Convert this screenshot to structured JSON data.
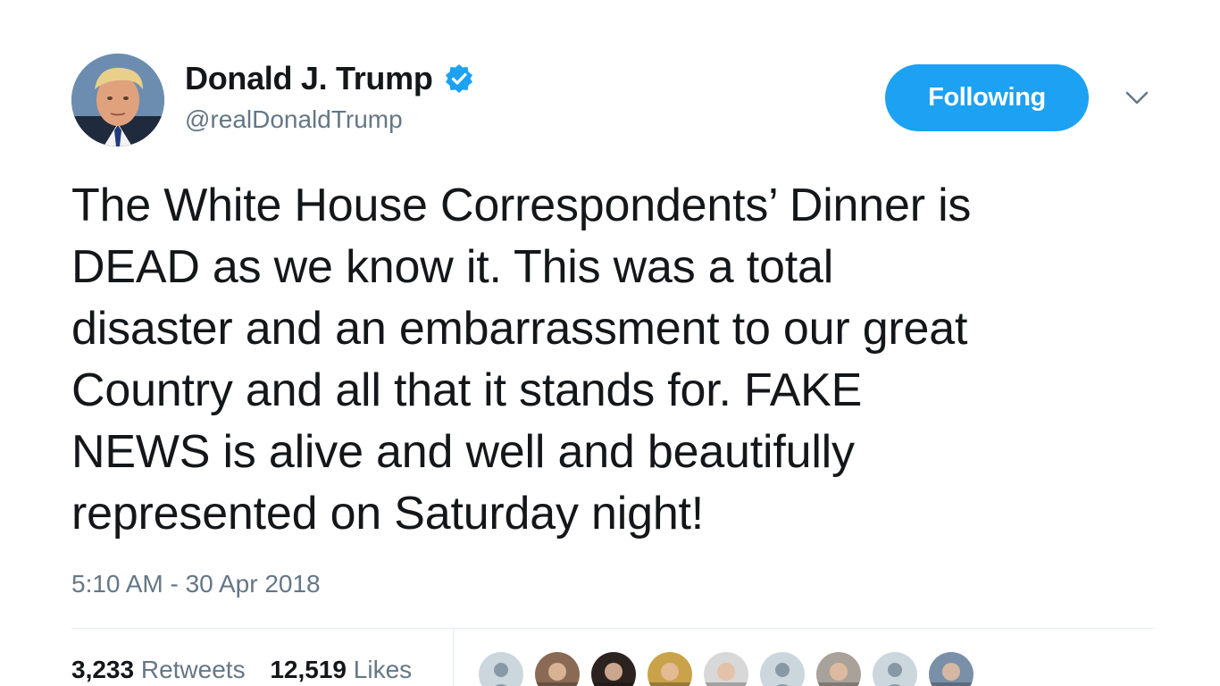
{
  "user": {
    "display_name": "Donald J. Trump",
    "handle": "@realDonaldTrump",
    "verified": true,
    "avatar_icon": "profile-photo"
  },
  "follow_button": {
    "label": "Following"
  },
  "menu": {
    "icon": "chevron-down-icon"
  },
  "tweet": {
    "text": "The White House Correspondents’ Dinner is\nDEAD as we know it. This was a total\ndisaster and an embarrassment to our great\nCountry and all that it stands for. FAKE\nNEWS is alive and well and beautifully\nrepresented on Saturday night!",
    "timestamp": "5:10 AM - 30 Apr 2018"
  },
  "stats": {
    "retweets_count": "3,233",
    "retweets_label": "Retweets",
    "likes_count": "12,519",
    "likes_label": "Likes"
  },
  "likers": [
    {
      "type": "default"
    },
    {
      "type": "photo",
      "color": "#8a6a55"
    },
    {
      "type": "photo",
      "color": "#2c2320"
    },
    {
      "type": "photo",
      "color": "#c9a24a"
    },
    {
      "type": "photo",
      "color": "#d8d8d8"
    },
    {
      "type": "default"
    },
    {
      "type": "photo",
      "color": "#a8a29a"
    },
    {
      "type": "default"
    },
    {
      "type": "photo",
      "color": "#7a8fa8"
    }
  ],
  "colors": {
    "accent": "#1da1f2",
    "text": "#14171a",
    "secondary_text": "#657786",
    "divider": "#e6ecf0"
  }
}
